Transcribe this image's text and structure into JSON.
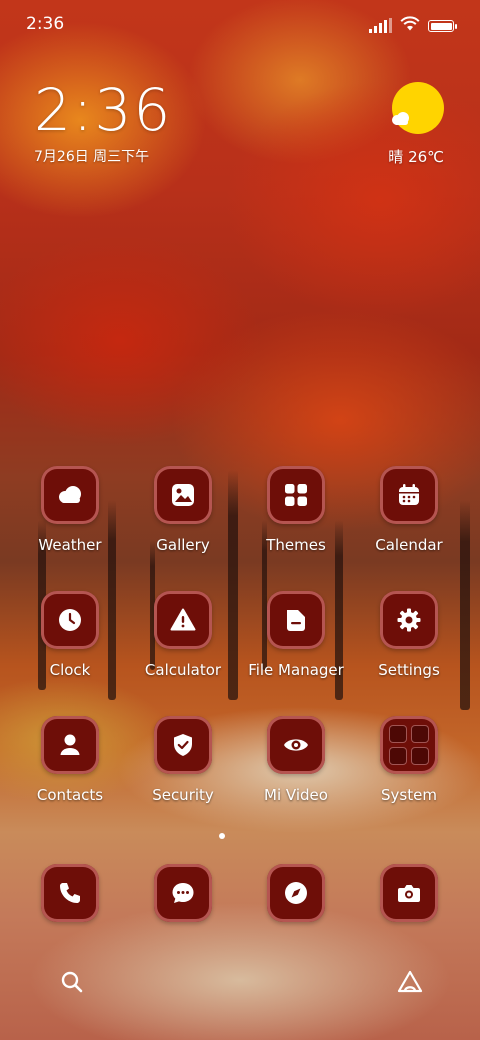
{
  "status_bar": {
    "time": "2:36",
    "icons": [
      "signal-icon",
      "wifi-icon",
      "battery-icon"
    ],
    "battery_level": 1.0
  },
  "clock_widget": {
    "time": "2:36",
    "date": "7月26日 周三下午"
  },
  "weather_widget": {
    "icon": "sunny-partly-cloudy-icon",
    "text": "晴 26℃"
  },
  "apps": [
    {
      "label": "Weather",
      "icon": "cloud-icon"
    },
    {
      "label": "Gallery",
      "icon": "image-icon"
    },
    {
      "label": "Themes",
      "icon": "grid-icon"
    },
    {
      "label": "Calendar",
      "icon": "calendar-icon"
    },
    {
      "label": "Clock",
      "icon": "clock-icon"
    },
    {
      "label": "Calculator",
      "icon": "warning-icon"
    },
    {
      "label": "File Manager",
      "icon": "folder-icon"
    },
    {
      "label": "Settings",
      "icon": "gear-icon"
    },
    {
      "label": "Contacts",
      "icon": "person-icon"
    },
    {
      "label": "Security",
      "icon": "shield-check-icon"
    },
    {
      "label": "Mi Video",
      "icon": "eye-icon"
    },
    {
      "label": "System",
      "icon": "folder-grid-icon"
    }
  ],
  "dock": [
    {
      "icon": "phone-icon"
    },
    {
      "icon": "chat-icon"
    },
    {
      "icon": "compass-icon"
    },
    {
      "icon": "camera-icon"
    }
  ],
  "bottom_bar": {
    "left_icon": "search-icon",
    "right_icon": "assistant-icon"
  },
  "colors": {
    "tile_background": "#6e0e08",
    "tile_border": "#cd6e69",
    "sun": "#ffd400"
  }
}
